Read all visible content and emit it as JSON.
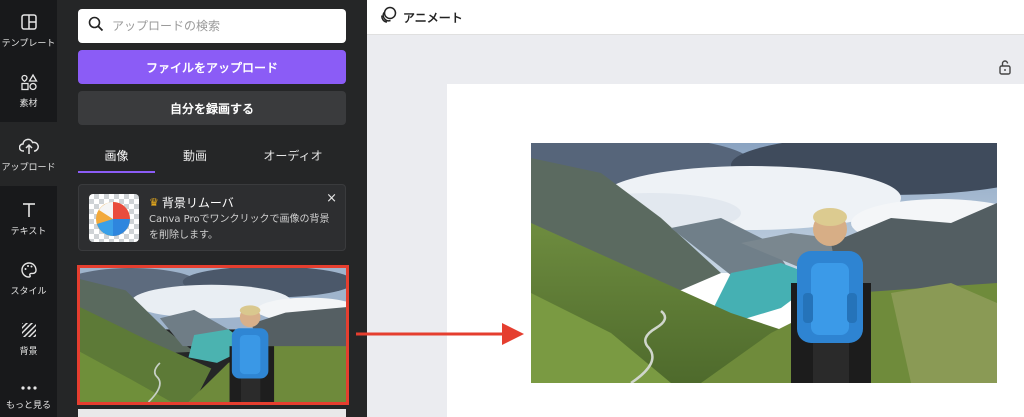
{
  "sidebar": {
    "items": [
      {
        "label": "テンプレート",
        "icon": "layout-icon"
      },
      {
        "label": "素材",
        "icon": "shapes-icon"
      },
      {
        "label": "アップロード",
        "icon": "cloud-upload-icon"
      },
      {
        "label": "テキスト",
        "icon": "text-icon"
      },
      {
        "label": "スタイル",
        "icon": "palette-icon"
      },
      {
        "label": "背景",
        "icon": "hatch-icon"
      },
      {
        "label": "もっと見る",
        "icon": "more-icon"
      }
    ]
  },
  "panel": {
    "search_placeholder": "アップロードの検索",
    "upload_button": "ファイルをアップロード",
    "record_button": "自分を録画する",
    "tabs": [
      {
        "label": "画像",
        "active": true
      },
      {
        "label": "動画",
        "active": false
      },
      {
        "label": "オーディオ",
        "active": false
      }
    ],
    "promo": {
      "title": "背景リムーバ",
      "description": "Canva Proでワンクリックで画像の背景を削除します。",
      "close": "×"
    }
  },
  "topbar": {
    "animate_label": "アニメート"
  },
  "colors": {
    "accent": "#8b5cf6",
    "highlight": "#e53e2f",
    "crown": "#f7b51b"
  }
}
